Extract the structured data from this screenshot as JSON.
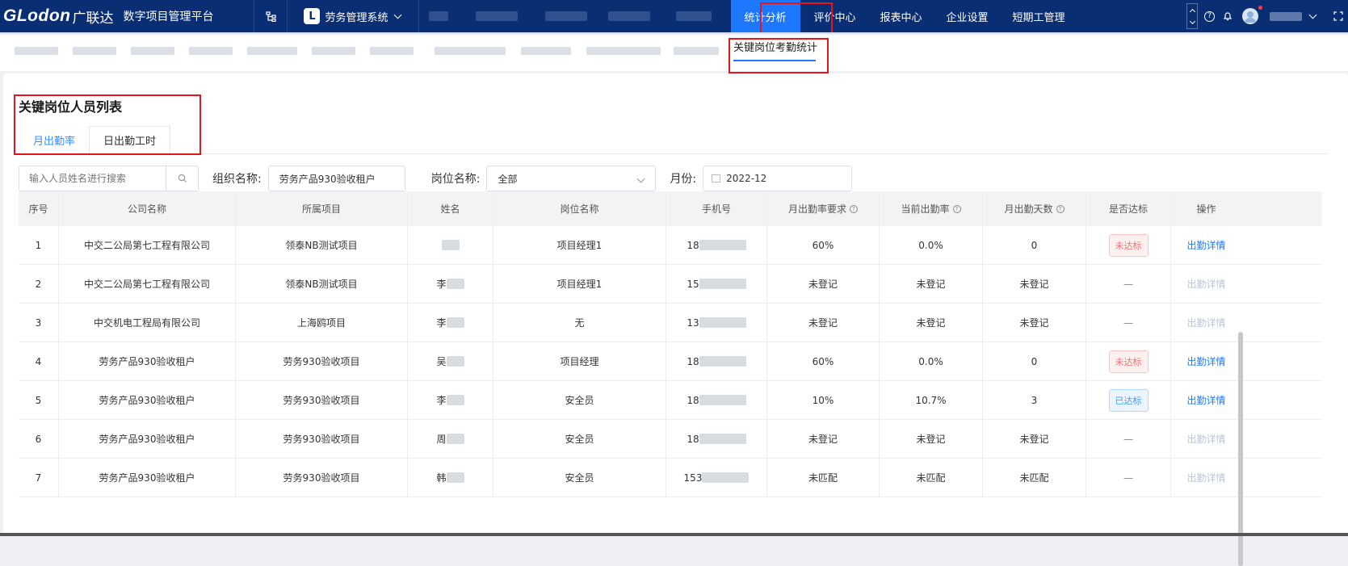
{
  "header": {
    "logo_en": "GLodon",
    "logo_cn": "广联达",
    "platform": "数字项目管理平台",
    "system_badge": "L",
    "system": "劳务管理系统",
    "nav": [
      {
        "label": "统计分析",
        "active": true
      },
      {
        "label": "评价中心",
        "active": false
      },
      {
        "label": "报表中心",
        "active": false
      },
      {
        "label": "企业设置",
        "active": false
      },
      {
        "label": "短期工管理",
        "active": false
      }
    ],
    "help_icon": "?",
    "icons": [
      "tree-icon",
      "question-icon",
      "bell-icon",
      "avatar",
      "chevron-down-icon",
      "expand-icon"
    ]
  },
  "subtabs": {
    "active": "关键岗位考勤统计"
  },
  "card": {
    "title": "关键岗位人员列表",
    "tabs": [
      "月出勤率",
      "日出勤工时"
    ]
  },
  "filters": {
    "search_placeholder": "输入人员姓名进行搜索",
    "org_label": "组织名称:",
    "org_value": "劳务产品930验收租户",
    "post_label": "岗位名称:",
    "post_value": "全部",
    "month_label": "月份:",
    "month_value": "2022-12"
  },
  "table": {
    "columns": [
      "序号",
      "公司名称",
      "所属项目",
      "姓名",
      "岗位名称",
      "手机号",
      "月出勤率要求",
      "当前出勤率",
      "月出勤天数",
      "是否达标",
      "操作"
    ],
    "rows": [
      {
        "no": "1",
        "company": "中交二公局第七工程有限公司",
        "project": "领泰NB测试项目",
        "name": "",
        "post": "项目经理1",
        "phone": "18",
        "req": "60%",
        "rate": "0.0%",
        "days": "0",
        "status": "未达标",
        "status_type": "red",
        "action": "出勤详情",
        "action_enabled": true
      },
      {
        "no": "2",
        "company": "中交二公局第七工程有限公司",
        "project": "领泰NB测试项目",
        "name": "李",
        "post": "项目经理1",
        "phone": "15",
        "req": "未登记",
        "rate": "未登记",
        "days": "未登记",
        "status": "—",
        "status_type": "none",
        "action": "出勤详情",
        "action_enabled": false
      },
      {
        "no": "3",
        "company": "中交机电工程局有限公司",
        "project": "上海鸥项目",
        "name": "李",
        "post": "无",
        "phone": "13",
        "req": "未登记",
        "rate": "未登记",
        "days": "未登记",
        "status": "—",
        "status_type": "none",
        "action": "出勤详情",
        "action_enabled": false
      },
      {
        "no": "4",
        "company": "劳务产品930验收租户",
        "project": "劳务930验收项目",
        "name": "吴",
        "post": "项目经理",
        "phone": "18",
        "req": "60%",
        "rate": "0.0%",
        "days": "0",
        "status": "未达标",
        "status_type": "red",
        "action": "出勤详情",
        "action_enabled": true
      },
      {
        "no": "5",
        "company": "劳务产品930验收租户",
        "project": "劳务930验收项目",
        "name": "李",
        "post": "安全员",
        "phone": "18",
        "req": "10%",
        "rate": "10.7%",
        "days": "3",
        "status": "已达标",
        "status_type": "blue",
        "action": "出勤详情",
        "action_enabled": true
      },
      {
        "no": "6",
        "company": "劳务产品930验收租户",
        "project": "劳务930验收项目",
        "name": "周",
        "post": "安全员",
        "phone": "18",
        "req": "未登记",
        "rate": "未登记",
        "days": "未登记",
        "status": "—",
        "status_type": "none",
        "action": "出勤详情",
        "action_enabled": false
      },
      {
        "no": "7",
        "company": "劳务产品930验收租户",
        "project": "劳务930验收项目",
        "name": "韩",
        "post": "安全员",
        "phone": "153",
        "req": "未匹配",
        "rate": "未匹配",
        "days": "未匹配",
        "status": "—",
        "status_type": "none",
        "action": "出勤详情",
        "action_enabled": false
      }
    ]
  },
  "colors": {
    "header_bg": "#0a2e73",
    "accent": "#1e78ff",
    "highlight": "#e8141c"
  }
}
